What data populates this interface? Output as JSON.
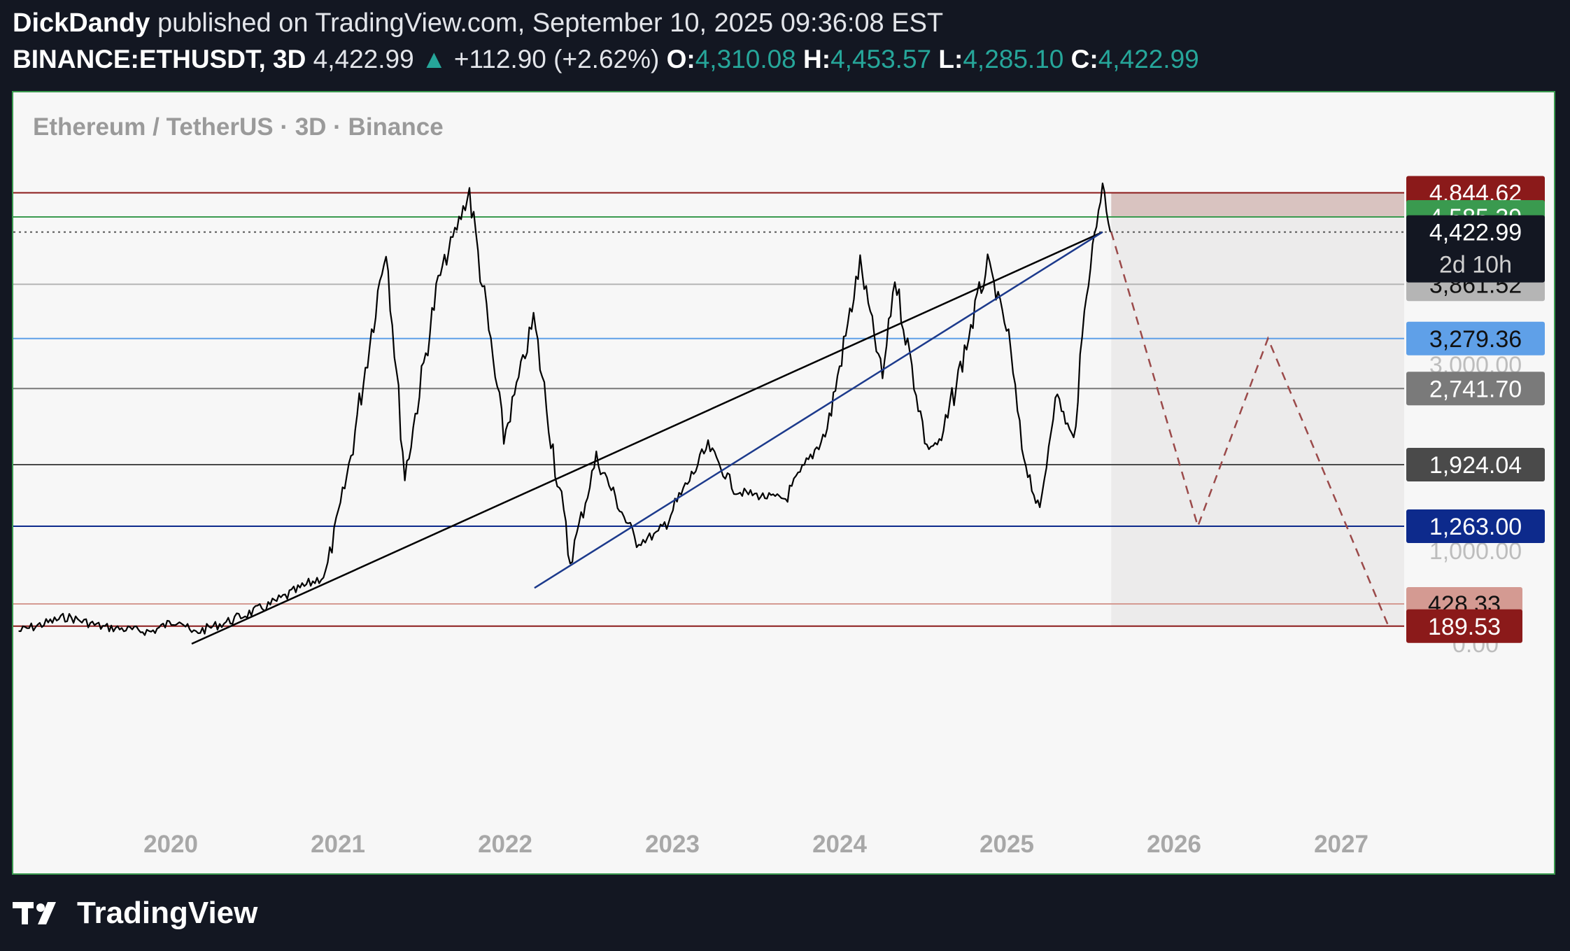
{
  "header": {
    "author": "DickDandy",
    "published_text": "published on TradingView.com, September 10, 2025 09:36:08 EST",
    "symbol": "BINANCE:ETHUSDT, 3D",
    "price": "4,422.99",
    "change_arrow": "▲",
    "change": "+112.90 (+2.62%)",
    "open_label": "O:",
    "open": "4,310.08",
    "high_label": "H:",
    "high": "4,453.57",
    "low_label": "L:",
    "low": "4,285.10",
    "close_label": "C:",
    "close": "4,422.99"
  },
  "chart_data": {
    "type": "line",
    "title": "Ethereum / TetherUS · 3D · Binance",
    "x_ticks": [
      "2020",
      "2021",
      "2022",
      "2023",
      "2024",
      "2025",
      "2026",
      "2027"
    ],
    "axis_ticks": [
      "3,000.00",
      "1,000.00",
      "0.00"
    ],
    "current_price": "4,422.99",
    "countdown": "2d 10h",
    "price_series": [
      [
        "2019-03-01",
        135
      ],
      [
        "2019-06-15",
        290
      ],
      [
        "2019-09-01",
        180
      ],
      [
        "2019-12-15",
        130
      ],
      [
        "2020-02-15",
        270
      ],
      [
        "2020-03-13",
        110
      ],
      [
        "2020-06-01",
        240
      ],
      [
        "2020-09-01",
        420
      ],
      [
        "2020-12-31",
        740
      ],
      [
        "2021-02-20",
        1900
      ],
      [
        "2021-05-12",
        4300
      ],
      [
        "2021-06-22",
        1800
      ],
      [
        "2021-09-03",
        3900
      ],
      [
        "2021-11-10",
        4860
      ],
      [
        "2022-01-24",
        2200
      ],
      [
        "2022-03-30",
        3480
      ],
      [
        "2022-06-18",
        880
      ],
      [
        "2022-08-14",
        2000
      ],
      [
        "2022-11-10",
        1080
      ],
      [
        "2023-01-01",
        1200
      ],
      [
        "2023-04-15",
        2120
      ],
      [
        "2023-06-15",
        1640
      ],
      [
        "2023-08-17",
        1580
      ],
      [
        "2023-10-01",
        1560
      ],
      [
        "2023-12-31",
        2300
      ],
      [
        "2024-03-12",
        4090
      ],
      [
        "2024-04-30",
        2850
      ],
      [
        "2024-05-27",
        3940
      ],
      [
        "2024-08-05",
        2110
      ],
      [
        "2024-09-06",
        2170
      ],
      [
        "2024-12-16",
        4100
      ],
      [
        "2025-01-31",
        3300
      ],
      [
        "2025-03-01",
        2100
      ],
      [
        "2025-04-09",
        1385
      ],
      [
        "2025-05-13",
        2700
      ],
      [
        "2025-06-22",
        2170
      ],
      [
        "2025-07-20",
        3800
      ],
      [
        "2025-08-24",
        4955
      ],
      [
        "2025-09-10",
        4422.99
      ]
    ],
    "horizontal_levels": [
      {
        "price": 4844.62,
        "label": "4,844.62",
        "color": "#8b1a1a"
      },
      {
        "price": 4585.39,
        "label": "4,585.39",
        "color": "#3a9a4f"
      },
      {
        "price": 3861.52,
        "label": "3,861.52",
        "color": "#b5b5b5"
      },
      {
        "price": 3279.36,
        "label": "3,279.36",
        "color": "#5fa0e8"
      },
      {
        "price": 2741.7,
        "label": "2,741.70",
        "color": "#7a7a7a"
      },
      {
        "price": 1924.04,
        "label": "1,924.04",
        "color": "#4a4a4a"
      },
      {
        "price": 1263.0,
        "label": "1,263.00",
        "color": "#0d2a8c"
      },
      {
        "price": 428.33,
        "label": "428.33",
        "color": "#d49a92"
      },
      {
        "price": 189.53,
        "label": "189.53",
        "color": "#8b1a1a"
      }
    ],
    "trendlines": [
      {
        "from": [
          "2020-03-13",
          0
        ],
        "to": [
          "2025-08-24",
          4422.99
        ],
        "color": "#000000"
      },
      {
        "from": [
          "2022-04-01",
          600
        ],
        "to": [
          "2025-08-24",
          4422.99
        ],
        "color": "#1c3a8c"
      }
    ],
    "projection": [
      [
        "2025-09-12",
        4422.99
      ],
      [
        "2026-03-20",
        1263.0
      ],
      [
        "2026-08-20",
        3279.36
      ],
      [
        "2027-05-10",
        189.53
      ]
    ]
  },
  "footer": {
    "brand": "TradingView"
  },
  "colors": {
    "background": "#131722",
    "chart_bg": "#f7f7f7",
    "up": "#26a69a",
    "frame": "#3a9a4f",
    "projection": "#9b4a4a"
  }
}
